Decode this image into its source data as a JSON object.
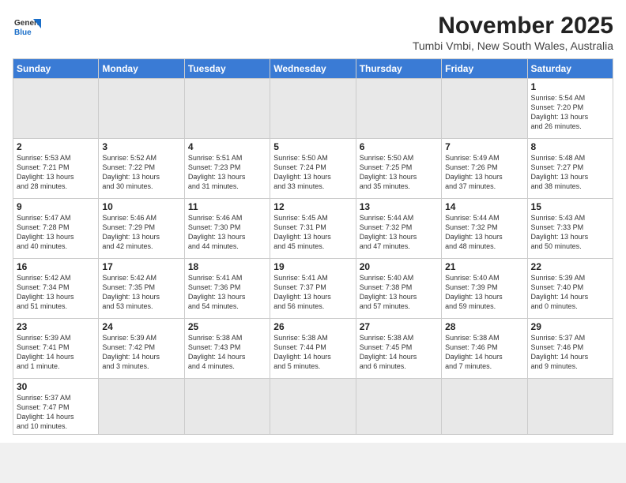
{
  "header": {
    "logo_general": "General",
    "logo_blue": "Blue",
    "title": "November 2025",
    "location": "Tumbi Vmbi, New South Wales, Australia"
  },
  "days_of_week": [
    "Sunday",
    "Monday",
    "Tuesday",
    "Wednesday",
    "Thursday",
    "Friday",
    "Saturday"
  ],
  "weeks": [
    [
      {
        "day": "",
        "info": ""
      },
      {
        "day": "",
        "info": ""
      },
      {
        "day": "",
        "info": ""
      },
      {
        "day": "",
        "info": ""
      },
      {
        "day": "",
        "info": ""
      },
      {
        "day": "",
        "info": ""
      },
      {
        "day": "1",
        "info": "Sunrise: 5:54 AM\nSunset: 7:20 PM\nDaylight: 13 hours\nand 26 minutes."
      }
    ],
    [
      {
        "day": "2",
        "info": "Sunrise: 5:53 AM\nSunset: 7:21 PM\nDaylight: 13 hours\nand 28 minutes."
      },
      {
        "day": "3",
        "info": "Sunrise: 5:52 AM\nSunset: 7:22 PM\nDaylight: 13 hours\nand 30 minutes."
      },
      {
        "day": "4",
        "info": "Sunrise: 5:51 AM\nSunset: 7:23 PM\nDaylight: 13 hours\nand 31 minutes."
      },
      {
        "day": "5",
        "info": "Sunrise: 5:50 AM\nSunset: 7:24 PM\nDaylight: 13 hours\nand 33 minutes."
      },
      {
        "day": "6",
        "info": "Sunrise: 5:50 AM\nSunset: 7:25 PM\nDaylight: 13 hours\nand 35 minutes."
      },
      {
        "day": "7",
        "info": "Sunrise: 5:49 AM\nSunset: 7:26 PM\nDaylight: 13 hours\nand 37 minutes."
      },
      {
        "day": "8",
        "info": "Sunrise: 5:48 AM\nSunset: 7:27 PM\nDaylight: 13 hours\nand 38 minutes."
      }
    ],
    [
      {
        "day": "9",
        "info": "Sunrise: 5:47 AM\nSunset: 7:28 PM\nDaylight: 13 hours\nand 40 minutes."
      },
      {
        "day": "10",
        "info": "Sunrise: 5:46 AM\nSunset: 7:29 PM\nDaylight: 13 hours\nand 42 minutes."
      },
      {
        "day": "11",
        "info": "Sunrise: 5:46 AM\nSunset: 7:30 PM\nDaylight: 13 hours\nand 44 minutes."
      },
      {
        "day": "12",
        "info": "Sunrise: 5:45 AM\nSunset: 7:31 PM\nDaylight: 13 hours\nand 45 minutes."
      },
      {
        "day": "13",
        "info": "Sunrise: 5:44 AM\nSunset: 7:32 PM\nDaylight: 13 hours\nand 47 minutes."
      },
      {
        "day": "14",
        "info": "Sunrise: 5:44 AM\nSunset: 7:32 PM\nDaylight: 13 hours\nand 48 minutes."
      },
      {
        "day": "15",
        "info": "Sunrise: 5:43 AM\nSunset: 7:33 PM\nDaylight: 13 hours\nand 50 minutes."
      }
    ],
    [
      {
        "day": "16",
        "info": "Sunrise: 5:42 AM\nSunset: 7:34 PM\nDaylight: 13 hours\nand 51 minutes."
      },
      {
        "day": "17",
        "info": "Sunrise: 5:42 AM\nSunset: 7:35 PM\nDaylight: 13 hours\nand 53 minutes."
      },
      {
        "day": "18",
        "info": "Sunrise: 5:41 AM\nSunset: 7:36 PM\nDaylight: 13 hours\nand 54 minutes."
      },
      {
        "day": "19",
        "info": "Sunrise: 5:41 AM\nSunset: 7:37 PM\nDaylight: 13 hours\nand 56 minutes."
      },
      {
        "day": "20",
        "info": "Sunrise: 5:40 AM\nSunset: 7:38 PM\nDaylight: 13 hours\nand 57 minutes."
      },
      {
        "day": "21",
        "info": "Sunrise: 5:40 AM\nSunset: 7:39 PM\nDaylight: 13 hours\nand 59 minutes."
      },
      {
        "day": "22",
        "info": "Sunrise: 5:39 AM\nSunset: 7:40 PM\nDaylight: 14 hours\nand 0 minutes."
      }
    ],
    [
      {
        "day": "23",
        "info": "Sunrise: 5:39 AM\nSunset: 7:41 PM\nDaylight: 14 hours\nand 1 minute."
      },
      {
        "day": "24",
        "info": "Sunrise: 5:39 AM\nSunset: 7:42 PM\nDaylight: 14 hours\nand 3 minutes."
      },
      {
        "day": "25",
        "info": "Sunrise: 5:38 AM\nSunset: 7:43 PM\nDaylight: 14 hours\nand 4 minutes."
      },
      {
        "day": "26",
        "info": "Sunrise: 5:38 AM\nSunset: 7:44 PM\nDaylight: 14 hours\nand 5 minutes."
      },
      {
        "day": "27",
        "info": "Sunrise: 5:38 AM\nSunset: 7:45 PM\nDaylight: 14 hours\nand 6 minutes."
      },
      {
        "day": "28",
        "info": "Sunrise: 5:38 AM\nSunset: 7:46 PM\nDaylight: 14 hours\nand 7 minutes."
      },
      {
        "day": "29",
        "info": "Sunrise: 5:37 AM\nSunset: 7:46 PM\nDaylight: 14 hours\nand 9 minutes."
      }
    ],
    [
      {
        "day": "30",
        "info": "Sunrise: 5:37 AM\nSunset: 7:47 PM\nDaylight: 14 hours\nand 10 minutes."
      },
      {
        "day": "",
        "info": ""
      },
      {
        "day": "",
        "info": ""
      },
      {
        "day": "",
        "info": ""
      },
      {
        "day": "",
        "info": ""
      },
      {
        "day": "",
        "info": ""
      },
      {
        "day": "",
        "info": ""
      }
    ]
  ]
}
